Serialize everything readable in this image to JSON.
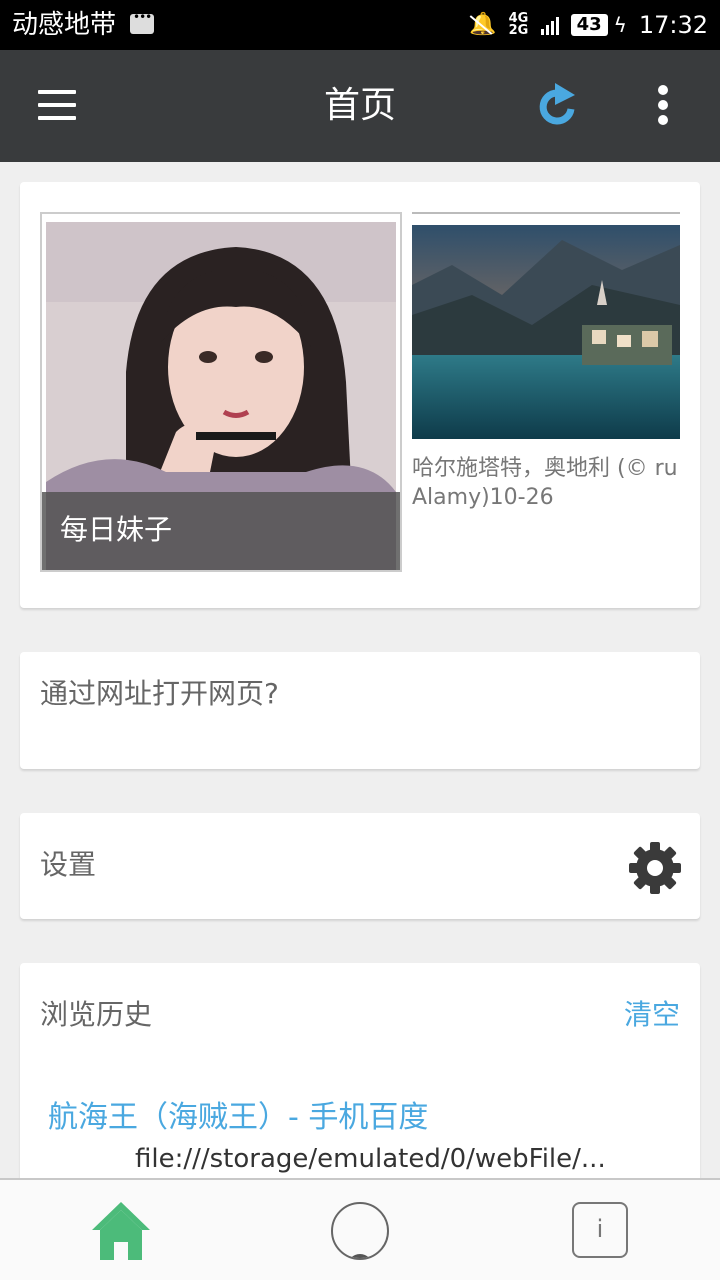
{
  "status_bar": {
    "carrier": "动感地带",
    "network": "4G 2G",
    "battery": "43",
    "time": "17:32"
  },
  "app_bar": {
    "title": "首页",
    "icons": [
      "menu-icon",
      "refresh-icon",
      "more-vert-icon"
    ],
    "refresh_color": "#4aa8e0"
  },
  "featured": {
    "items": [
      {
        "caption": "每日妹子"
      },
      {
        "caption": "哈尔施塔特，奥地利 (© ru\nAlamy)10-26"
      }
    ]
  },
  "url_card": {
    "label": "通过网址打开网页?"
  },
  "settings_card": {
    "label": "设置",
    "icon": "gear-icon"
  },
  "history": {
    "label": "浏览历史",
    "clear_label": "清空",
    "items": [
      {
        "title": "航海王（海贼王）- 手机百度",
        "url": "file:///storage/emulated/0/webFile/..."
      }
    ]
  },
  "bottom_nav": {
    "items": [
      "home-icon",
      "circle-icon",
      "info-icon"
    ],
    "info_glyph": "i",
    "active_color": "#4cbb7a"
  },
  "colors": {
    "app_bar": "#393b3d",
    "accent": "#4aa8e0",
    "background": "#efefef"
  }
}
